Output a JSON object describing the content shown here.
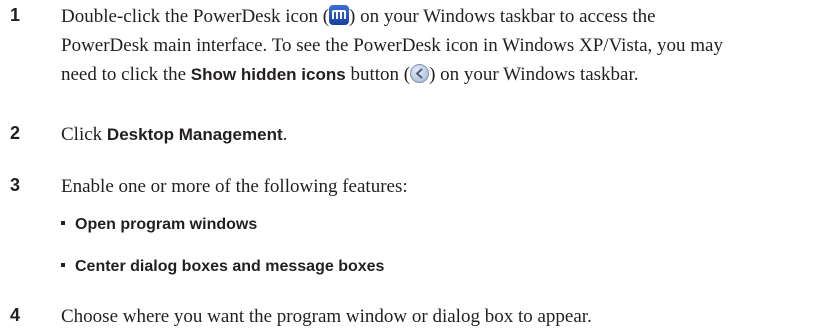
{
  "steps": [
    {
      "number": "1",
      "line1_pre": "Double-click the PowerDesk icon (",
      "line1_post": ") on your Windows taskbar to access the",
      "line2": "PowerDesk main interface. To see the PowerDesk icon in Windows XP/Vista, you may",
      "line3_pre": "need to click the ",
      "line3_bold": "Show hidden icons",
      "line3_mid": " button (",
      "line3_post": ") on your Windows taskbar."
    },
    {
      "number": "2",
      "pre": "Click ",
      "bold": "Desktop Management",
      "post": "."
    },
    {
      "number": "3",
      "text": "Enable one or more of the following features:",
      "bullets": [
        "Open program windows",
        "Center dialog boxes and message boxes"
      ]
    },
    {
      "number": "4",
      "text": "Choose where you want the program window or dialog box to appear."
    }
  ],
  "icons": {
    "powerdesk": "powerdesk-icon",
    "show_hidden": "show-hidden-icons-button-icon"
  }
}
